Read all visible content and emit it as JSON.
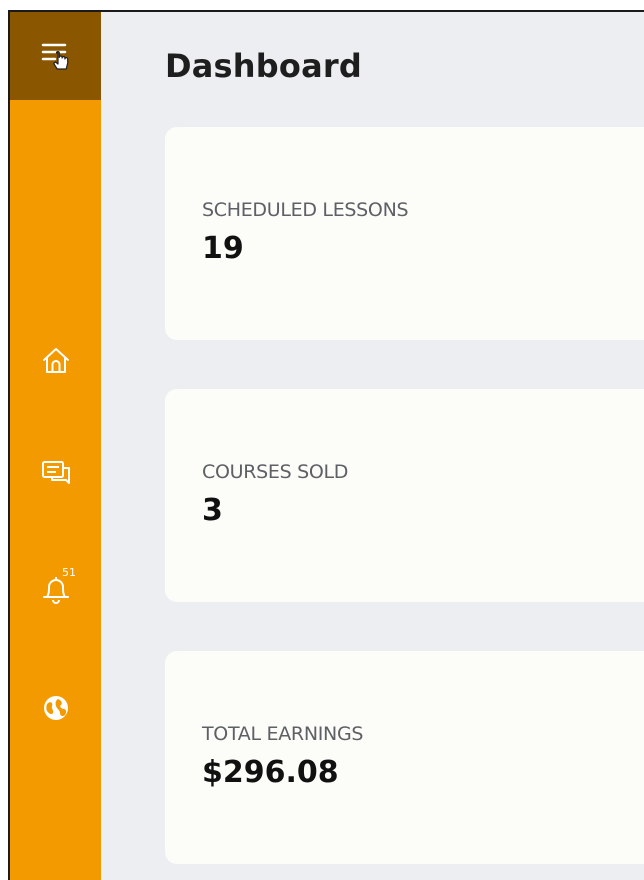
{
  "header": {
    "title": "Dashboard"
  },
  "sidebar": {
    "accent_color": "#f39a00",
    "toggle_color": "#8a5600",
    "items": [
      {
        "icon": "home-icon"
      },
      {
        "icon": "chat-icon"
      },
      {
        "icon": "bell-icon",
        "badge": "51"
      },
      {
        "icon": "globe-icon"
      }
    ]
  },
  "cards": [
    {
      "label": "SCHEDULED LESSONS",
      "value": "19"
    },
    {
      "label": "COURSES SOLD",
      "value": "3"
    },
    {
      "label": "TOTAL EARNINGS",
      "value": "$296.08"
    }
  ]
}
